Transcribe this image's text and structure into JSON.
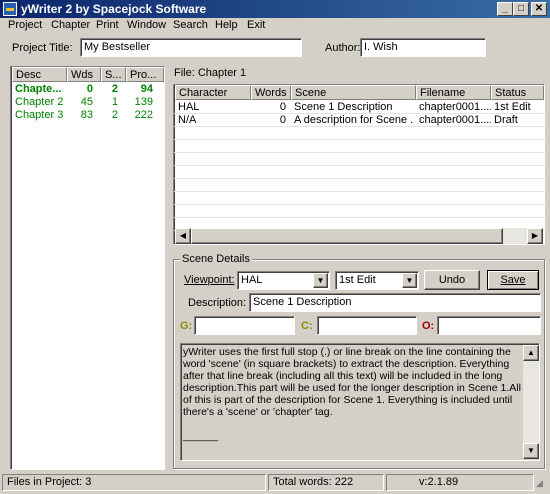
{
  "window": {
    "title": "yWriter 2 by Spacejock Software",
    "minimize": "_",
    "maximize": "□",
    "close": "✕"
  },
  "menu": [
    "Project",
    "Chapter",
    "Print",
    "Window",
    "Search",
    "Help",
    "Exit"
  ],
  "project": {
    "title_label": "Project Title:",
    "title_value": "My Bestseller",
    "author_label": "Author:",
    "author_value": "I. Wish"
  },
  "chapters": {
    "headers": [
      "Desc",
      "Wds",
      "S...",
      "Pro..."
    ],
    "rows": [
      {
        "desc": "Chapte...",
        "wds": "0",
        "scenes": "2",
        "pro": "94",
        "bold": true
      },
      {
        "desc": "Chapter 2",
        "wds": "45",
        "scenes": "1",
        "pro": "139",
        "bold": false
      },
      {
        "desc": "Chapter 3",
        "wds": "83",
        "scenes": "2",
        "pro": "222",
        "bold": false
      }
    ],
    "text_color": "#008000"
  },
  "file_label": "File: Chapter 1",
  "scenes": {
    "headers": [
      "Character",
      "Words",
      "Scene",
      "Filename",
      "Status"
    ],
    "rows": [
      {
        "character": "HAL",
        "words": "0",
        "scene": "Scene 1 Description",
        "filename": "chapter0001....",
        "status": "1st Edit"
      },
      {
        "character": "N/A",
        "words": "0",
        "scene": "A description for Scene ...",
        "filename": "chapter0001....",
        "status": "Draft"
      }
    ]
  },
  "details": {
    "group_label": "Scene Details",
    "viewpoint_label": "Viewpoint:",
    "viewpoint_value": "HAL",
    "status_value": "1st Edit",
    "undo": "Undo",
    "save": "Save",
    "description_label": "Description:",
    "description_value": "Scene 1 Description",
    "g_label": "G:",
    "c_label": "C:",
    "o_label": "O:",
    "g_color": "#8b8b00",
    "c_color": "#8b8b00",
    "o_color": "#a00000",
    "body_text": "yWriter uses the first full stop (.) or line break on the line containing the word 'scene' (in square brackets) to extract the description.  Everything after that line break (including all this text) will be included in the long description.This part will be used for the longer description in Scene 1.All of this is part of the description for Scene 1.  Everything is included until there's a 'scene' or 'chapter' tag.",
    "body_tail": "______"
  },
  "status": {
    "files": "Files in Project: 3",
    "words": "Total words: 222",
    "version": "v:2.1.89"
  }
}
